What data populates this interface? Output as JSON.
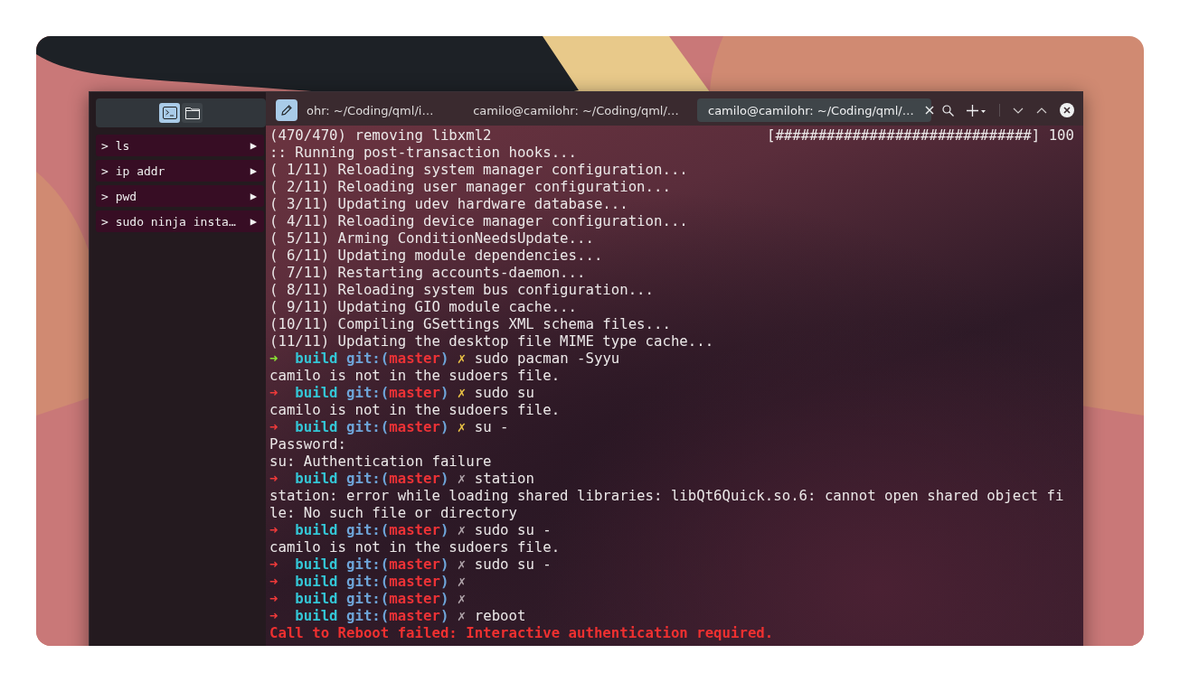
{
  "sidebar": {
    "toolbar": [
      {
        "kind": "terminal",
        "selected": true
      },
      {
        "kind": "folder",
        "selected": false
      }
    ],
    "commands": [
      {
        "label": "> ls",
        "run": "▶"
      },
      {
        "label": "> ip addr",
        "run": "▶"
      },
      {
        "label": "> pwd",
        "run": "▶"
      },
      {
        "label": "> sudo ninja insta…",
        "run": "▶"
      }
    ]
  },
  "tabs": [
    {
      "label": "ohr: ~/Coding/qml/i…",
      "selected": false
    },
    {
      "label": "camilo@camilohr: ~/Coding/qml/…",
      "selected": false
    },
    {
      "label": "camilo@camilohr: ~/Coding/qml/…",
      "selected": true
    }
  ],
  "terminal": {
    "lines": [
      {
        "kind": "progress",
        "text": "(470/470) removing libxml2",
        "bar": "[##############################] 100"
      },
      {
        "kind": "text",
        "text": ":: Running post-transaction hooks..."
      },
      {
        "kind": "text",
        "text": "( 1/11) Reloading system manager configuration..."
      },
      {
        "kind": "text",
        "text": "( 2/11) Reloading user manager configuration..."
      },
      {
        "kind": "text",
        "text": "( 3/11) Updating udev hardware database..."
      },
      {
        "kind": "text",
        "text": "( 4/11) Reloading device manager configuration..."
      },
      {
        "kind": "text",
        "text": "( 5/11) Arming ConditionNeedsUpdate..."
      },
      {
        "kind": "text",
        "text": "( 6/11) Updating module dependencies..."
      },
      {
        "kind": "text",
        "text": "( 7/11) Restarting accounts-daemon..."
      },
      {
        "kind": "text",
        "text": "( 8/11) Reloading system bus configuration..."
      },
      {
        "kind": "text",
        "text": "( 9/11) Updating GIO module cache..."
      },
      {
        "kind": "text",
        "text": "(10/11) Compiling GSettings XML schema files..."
      },
      {
        "kind": "text",
        "text": "(11/11) Updating the desktop file MIME type cache..."
      },
      {
        "kind": "prompt",
        "ok": true,
        "arrow": "➜",
        "dir": "build",
        "git": "git:(",
        "branch": "master",
        "git_end": ")",
        "mark": "✗",
        "mark_lit": true,
        "command": "sudo pacman -Syyu"
      },
      {
        "kind": "text",
        "text": "camilo is not in the sudoers file."
      },
      {
        "kind": "prompt",
        "ok": false,
        "arrow": "➜",
        "dir": "build",
        "git": "git:(",
        "branch": "master",
        "git_end": ")",
        "mark": "✗",
        "mark_lit": true,
        "command": "sudo su"
      },
      {
        "kind": "text",
        "text": "camilo is not in the sudoers file."
      },
      {
        "kind": "prompt",
        "ok": false,
        "arrow": "➜",
        "dir": "build",
        "git": "git:(",
        "branch": "master",
        "git_end": ")",
        "mark": "✗",
        "mark_lit": true,
        "command": "su -"
      },
      {
        "kind": "text",
        "text": "Password:"
      },
      {
        "kind": "text",
        "text": "su: Authentication failure"
      },
      {
        "kind": "prompt",
        "ok": false,
        "arrow": "➜",
        "dir": "build",
        "git": "git:(",
        "branch": "master",
        "git_end": ")",
        "mark": "✗",
        "mark_lit": false,
        "command": "station"
      },
      {
        "kind": "text",
        "text": "station: error while loading shared libraries: libQt6Quick.so.6: cannot open shared object fi"
      },
      {
        "kind": "text",
        "text": "le: No such file or directory"
      },
      {
        "kind": "prompt",
        "ok": false,
        "arrow": "➜",
        "dir": "build",
        "git": "git:(",
        "branch": "master",
        "git_end": ")",
        "mark": "✗",
        "mark_lit": false,
        "command": "sudo su -"
      },
      {
        "kind": "text",
        "text": "camilo is not in the sudoers file."
      },
      {
        "kind": "prompt",
        "ok": false,
        "arrow": "➜",
        "dir": "build",
        "git": "git:(",
        "branch": "master",
        "git_end": ")",
        "mark": "✗",
        "mark_lit": false,
        "command": "sudo su -"
      },
      {
        "kind": "prompt",
        "ok": false,
        "arrow": "➜",
        "dir": "build",
        "git": "git:(",
        "branch": "master",
        "git_end": ")",
        "mark": "✗",
        "mark_lit": false
      },
      {
        "kind": "prompt",
        "ok": false,
        "arrow": "➜",
        "dir": "build",
        "git": "git:(",
        "branch": "master",
        "git_end": ")",
        "mark": "✗",
        "mark_lit": false
      },
      {
        "kind": "prompt",
        "ok": false,
        "arrow": "➜",
        "dir": "build",
        "git": "git:(",
        "branch": "master",
        "git_end": ")",
        "mark": "✗",
        "mark_lit": false,
        "command": "reboot"
      },
      {
        "kind": "error",
        "text": "Call to Reboot failed: Interactive authentication required."
      }
    ]
  }
}
